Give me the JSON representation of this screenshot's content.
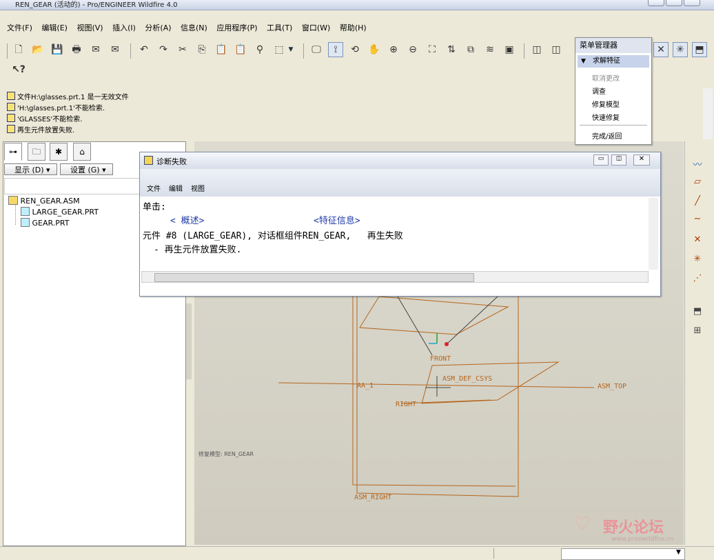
{
  "window": {
    "title": "REN_GEAR (活动的) - Pro/ENGINEER Wildfire 4.0"
  },
  "menubar": {
    "items": [
      "文件(F)",
      "编辑(E)",
      "视图(V)",
      "插入(I)",
      "分析(A)",
      "信息(N)",
      "应用程序(P)",
      "工具(T)",
      "窗口(W)",
      "帮助(H)"
    ]
  },
  "messages": [
    "文件H:\\glasses.prt.1 是一无效文件",
    "'H:\\glasses.prt.1'不能检索.",
    "'GLASSES'不能检索.",
    "再生元件放置失败."
  ],
  "left_panel": {
    "show_button": "显示 (D) ▾",
    "settings_button": "设置 (G) ▾",
    "tree": {
      "root": "REN_GEAR.ASM",
      "children": [
        "LARGE_GEAR.PRT",
        "GEAR.PRT"
      ]
    }
  },
  "dialog": {
    "title": "诊断失败",
    "menu": [
      "文件",
      "编辑",
      "视图"
    ],
    "click_label": "单击:",
    "link_summary": "< 概述>",
    "link_feature": "<特征信息>",
    "line1": "元件 #8 (LARGE_GEAR), 对话框组件REN_GEAR,   再生失败",
    "line2": "- 再生元件放置失败."
  },
  "menu_manager": {
    "title": "菜单管理器",
    "selected": "求解特征",
    "items": [
      {
        "label": "取消更改",
        "enabled": false
      },
      {
        "label": "调查",
        "enabled": true
      },
      {
        "label": "修复模型",
        "enabled": true
      },
      {
        "label": "快速修复",
        "enabled": true
      }
    ],
    "done": "完成/返回"
  },
  "graphics": {
    "labels": [
      "FRONT",
      "AA_1",
      "ASM_DEF_CSYS",
      "ASM_TOP",
      "RIGHT",
      "ASM_RIGHT"
    ],
    "model_label": "修复模型: REN_GEAR",
    "datum_color": "#b5651d"
  },
  "watermark": {
    "text": "野火论坛",
    "url": "www.proewildfire.cn"
  },
  "colors": {
    "link": "#1f3aa8",
    "accent_select": "#c7d3ea"
  }
}
